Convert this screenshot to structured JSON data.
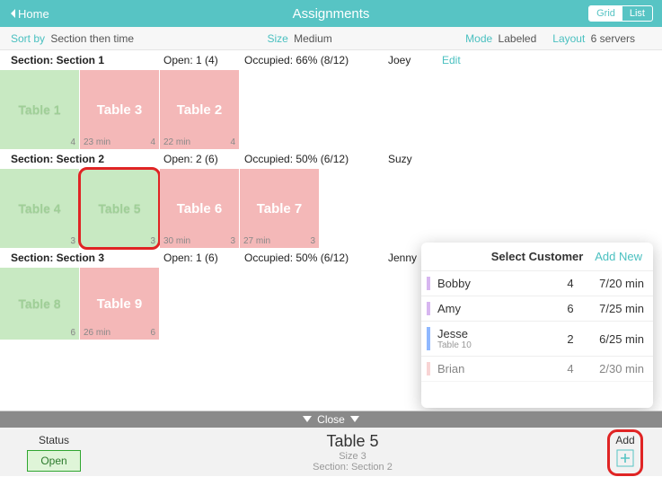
{
  "header": {
    "home": "Home",
    "title": "Assignments",
    "views": {
      "grid": "Grid",
      "list": "List",
      "active": "grid"
    }
  },
  "subbar": {
    "sort_lbl": "Sort by",
    "sort_val": "Section then time",
    "size_lbl": "Size",
    "size_val": "Medium",
    "mode_lbl": "Mode",
    "mode_val": "Labeled",
    "layout_lbl": "Layout",
    "layout_val": "6 servers"
  },
  "sections": [
    {
      "name": "Section: Section 1",
      "open": "Open: 1 (4)",
      "occupied": "Occupied: 66% (8/12)",
      "server": "Joey",
      "edit": "Edit",
      "tables": [
        {
          "name": "Table 1",
          "state": "open",
          "cap": "4"
        },
        {
          "name": "Table 3",
          "state": "occ",
          "time": "23 min",
          "cap": "4"
        },
        {
          "name": "Table 2",
          "state": "occ",
          "time": "22 min",
          "cap": "4"
        }
      ]
    },
    {
      "name": "Section: Section 2",
      "open": "Open: 2 (6)",
      "occupied": "Occupied: 50% (6/12)",
      "server": "Suzy",
      "tables": [
        {
          "name": "Table 4",
          "state": "open",
          "cap": "3"
        },
        {
          "name": "Table 5",
          "state": "open",
          "cap": "3",
          "selected": true
        },
        {
          "name": "Table 6",
          "state": "occ",
          "time": "30 min",
          "cap": "3"
        },
        {
          "name": "Table 7",
          "state": "occ",
          "time": "27 min",
          "cap": "3"
        }
      ]
    },
    {
      "name": "Section: Section 3",
      "open": "Open: 1 (6)",
      "occupied": "Occupied: 50% (6/12)",
      "server": "Jenny",
      "tables": [
        {
          "name": "Table 8",
          "state": "open",
          "cap": "6"
        },
        {
          "name": "Table 9",
          "state": "occ",
          "time": "26 min",
          "cap": "6"
        }
      ]
    }
  ],
  "customer_popover": {
    "title": "Select Customer",
    "add_new": "Add New",
    "items": [
      {
        "name": "Bobby",
        "size": "4",
        "wait": "7/20 min",
        "color": "#d7b6f0"
      },
      {
        "name": "Amy",
        "size": "6",
        "wait": "7/25 min",
        "color": "#d7b6f0"
      },
      {
        "name": "Jesse",
        "sub": "Table 10",
        "size": "2",
        "wait": "6/25 min",
        "color": "#8fb8ff"
      },
      {
        "name": "Brian",
        "size": "4",
        "wait": "2/30 min",
        "color": "#f4b8b8"
      }
    ]
  },
  "bottom": {
    "close": "Close",
    "status_hd": "Status",
    "open_btn": "Open",
    "table_name": "Table 5",
    "table_size": "Size 3",
    "table_section": "Section: Section 2",
    "add_hd": "Add"
  }
}
